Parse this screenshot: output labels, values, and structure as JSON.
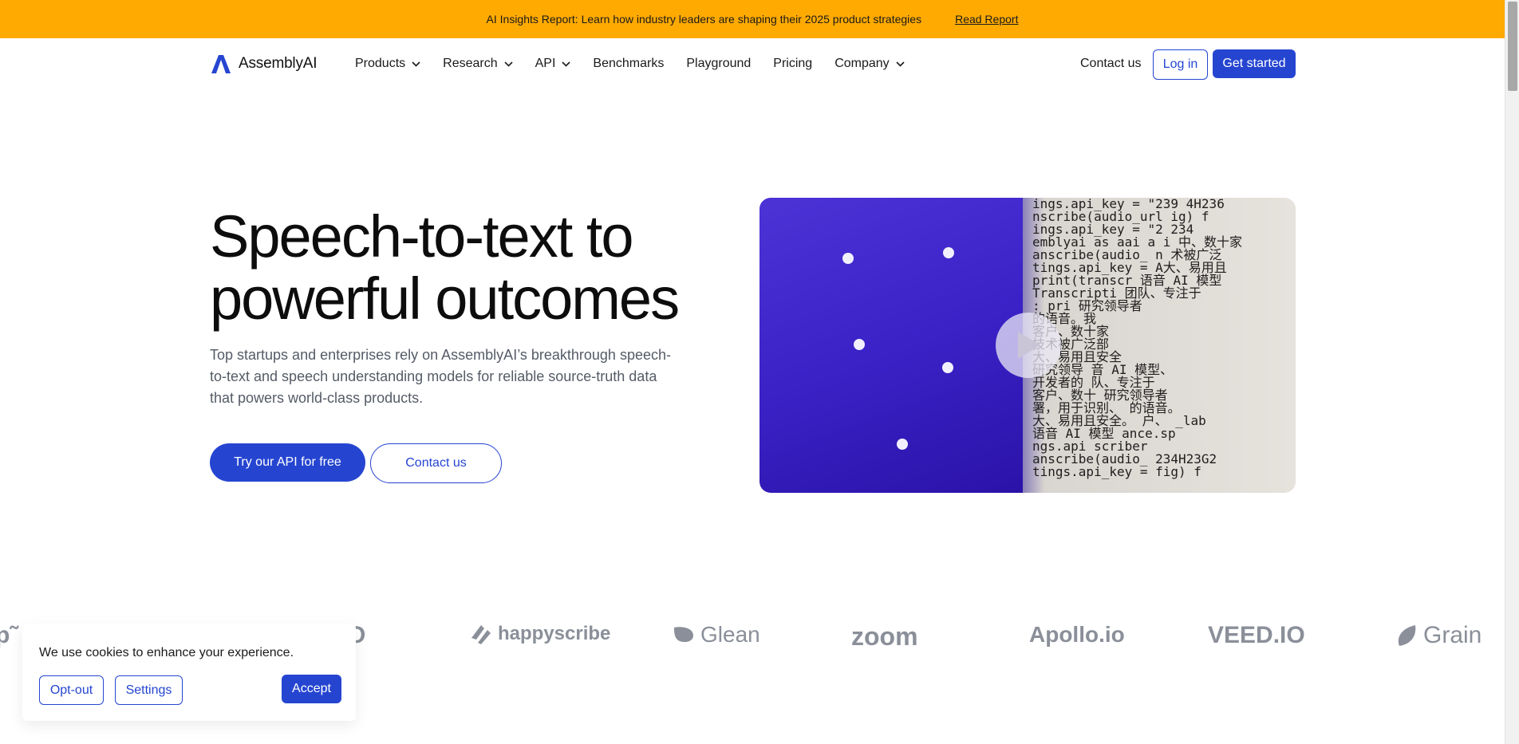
{
  "banner": {
    "text": "AI Insights Report: Learn how industry leaders are shaping their 2025 product strategies",
    "link": "Read Report"
  },
  "nav": {
    "logo": "AssemblyAI",
    "items": [
      {
        "label": "Products",
        "dropdown": true
      },
      {
        "label": "Research",
        "dropdown": true
      },
      {
        "label": "API",
        "dropdown": true
      },
      {
        "label": "Benchmarks",
        "dropdown": false
      },
      {
        "label": "Playground",
        "dropdown": false
      },
      {
        "label": "Pricing",
        "dropdown": false
      },
      {
        "label": "Company",
        "dropdown": true
      }
    ],
    "contact": "Contact us",
    "login": "Log in",
    "get_started": "Get started"
  },
  "hero": {
    "title_line1": "Speech-to-text to",
    "title_line2": "powerful outcomes",
    "subtitle": "Top startups and enterprises rely on AssemblyAI’s breakthrough speech-to-text and speech understanding models for reliable source-truth data that powers world-class products.",
    "cta_primary": "Try our API for free",
    "cta_secondary": "Contact us"
  },
  "video": {
    "code_lines": [
      "ings.api_key = \"239    4H236",
      "nscribe(audio_url    ig)  f",
      "ings.api_key = \"2     234",
      "emblyai as aai a     i 中、数十家",
      "anscribe(audio_     n 术被广泛",
      "tings.api_key =     A大、易用且",
      "print(transcr      语音 AI 模型",
      "Transcripti        团队、专注于",
      ": pri              研究领导者",
      "                   的语音。我",
      "                   客户、数十家",
      "                   技术被广泛部",
      "                   大、易用且安全",
      "研究领导           音 AI 模型、",
      "开发者的           队、专注于",
      "客户、数十         研究领导者",
      "署，用于识别、     的语音。",
      "大、易用且安全。    户、 _lab",
      "语音 AI 模型       ance.sp",
      "ngs.api            scriber",
      "anscribe(audio_    234H23G2",
      "tings.api_key =    fig)  f"
    ],
    "play_icon": "play-icon",
    "accent_color": "#3a22c7"
  },
  "logos": {
    "items": [
      "happyscribe",
      "Glean",
      "zoom",
      "Apollo.io",
      "VEED.IO",
      "Grain"
    ]
  },
  "cookie": {
    "text": "We use cookies to enhance your experience.",
    "opt_out": "Opt-out",
    "settings": "Settings",
    "accept": "Accept"
  },
  "colors": {
    "banner": "#ffaa00",
    "primary": "#2545d1",
    "logo_gray": "#8a8f99"
  }
}
